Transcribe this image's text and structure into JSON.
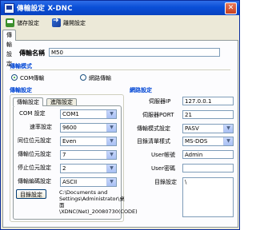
{
  "window": {
    "title": "傳輸設定 X-DNC"
  },
  "toolbar": {
    "save_label": "儲存設定",
    "exit_label": "離開設定"
  },
  "tabs": [
    "傳輸設定"
  ],
  "transfer_name": {
    "label": "傳輸名稱",
    "value": "M50"
  },
  "transfer_mode": {
    "title": "傳輸模式",
    "options": [
      "COM傳輸",
      "網路傳輸"
    ],
    "selected": 0
  },
  "transfer_settings": {
    "title": "傳輸設定",
    "subtabs": [
      "傳輸設定",
      "進階設定"
    ],
    "fields": [
      {
        "label": "COM 設定",
        "value": "COM1"
      },
      {
        "label": "速率設定",
        "value": "9600"
      },
      {
        "label": "同位位元設定",
        "value": "Even"
      },
      {
        "label": "傳輸位元設定",
        "value": "7"
      },
      {
        "label": "停止位元設定",
        "value": "2"
      },
      {
        "label": "傳輸編碼設定",
        "value": "ASCII"
      }
    ],
    "dir_button": "目錄設定",
    "path": "C:\\Documents and Settings\\Administrator\\桌面\\XDNC(Net)_20080730(CODE)"
  },
  "network_settings": {
    "title": "網路設定",
    "fields": [
      {
        "label": "伺服器IP",
        "value": "127.0.0.1",
        "kind": "input"
      },
      {
        "label": "伺服器PORT",
        "value": "21",
        "kind": "input"
      },
      {
        "label": "傳輸模式設定",
        "value": "PASV",
        "kind": "select"
      },
      {
        "label": "目錄清單樣式",
        "value": "MS-DOS",
        "kind": "select"
      },
      {
        "label": "User帳號",
        "value": "Admin",
        "kind": "input"
      },
      {
        "label": "User密碼",
        "value": "",
        "kind": "input"
      },
      {
        "label": "目錄設定",
        "value": "\\",
        "kind": "input"
      }
    ]
  }
}
